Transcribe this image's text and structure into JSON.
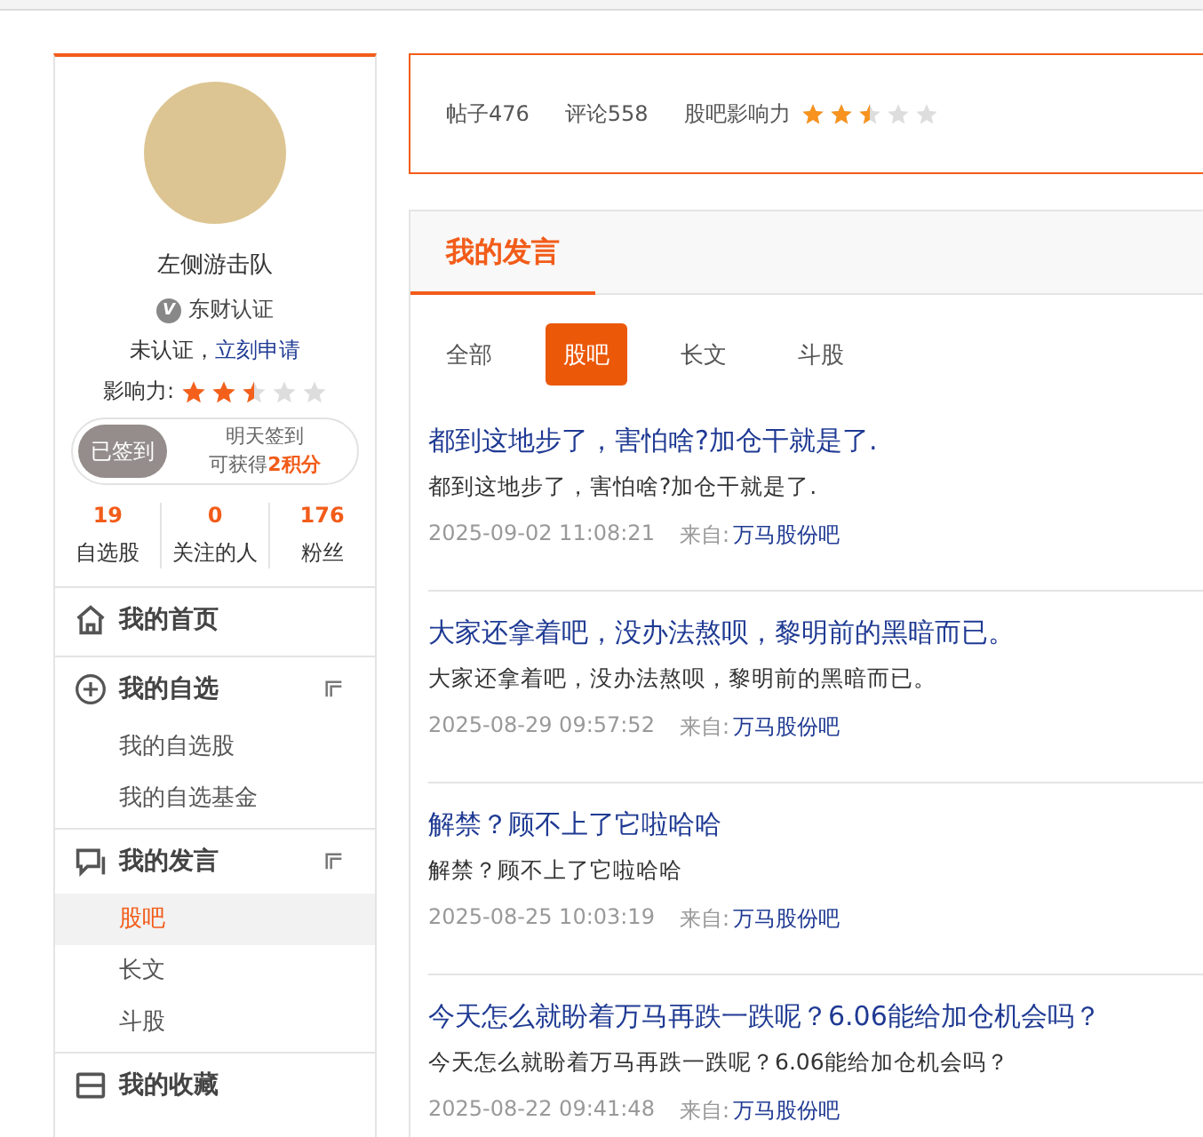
{
  "profile": {
    "name": "左侧游击队",
    "verify_label": "东财认证",
    "verify_icon": "V",
    "verify_status": "未认证，",
    "verify_link": "立刻申请",
    "influence_label": "影响力:",
    "stars": 2.5,
    "checkin": {
      "button": "已签到",
      "checked": true,
      "line1": "明天签到",
      "line2_prefix": "可获得",
      "line2_points": "2积分"
    },
    "counts": [
      {
        "value": "19",
        "label": "自选股"
      },
      {
        "value": "0",
        "label": "关注的人"
      },
      {
        "value": "176",
        "label": "粉丝"
      }
    ]
  },
  "menu": [
    {
      "kind": "home",
      "title": "我的首页"
    },
    {
      "kind": "plus",
      "title": "我的自选",
      "collapsible": true,
      "children": [
        {
          "label": "我的自选股",
          "selected": false
        },
        {
          "label": "我的自选基金",
          "selected": false
        }
      ]
    },
    {
      "kind": "chat",
      "title": "我的发言",
      "collapsible": true,
      "children": [
        {
          "label": "股吧",
          "selected": true
        },
        {
          "label": "长文",
          "selected": false
        },
        {
          "label": "斗股",
          "selected": false
        }
      ]
    },
    {
      "kind": "box",
      "title": "我的收藏"
    }
  ],
  "stats": {
    "posts": "帖子476",
    "comments": "评论558",
    "influence_label": "股吧影响力",
    "stars": 2.5
  },
  "section": {
    "title": "我的发言",
    "tabs": [
      {
        "label": "全部",
        "selected": false
      },
      {
        "label": "股吧",
        "selected": true
      },
      {
        "label": "长文",
        "selected": false
      },
      {
        "label": "斗股",
        "selected": false
      }
    ],
    "posts": [
      {
        "title": "都到这地步了，害怕啥?加仓干就是了.",
        "body": "都到这地步了，害怕啥?加仓干就是了.",
        "time": "2025-09-02 11:08:21",
        "from_label": "来自:",
        "from": "万马股份吧"
      },
      {
        "title": "大家还拿着吧，没办法熬呗，黎明前的黑暗而已。",
        "body": "大家还拿着吧，没办法熬呗，黎明前的黑暗而已。",
        "time": "2025-08-29 09:57:52",
        "from_label": "来自:",
        "from": "万马股份吧"
      },
      {
        "title": "解禁？顾不上了它啦哈哈",
        "body": "解禁？顾不上了它啦哈哈",
        "time": "2025-08-25 10:03:19",
        "from_label": "来自:",
        "from": "万马股份吧"
      },
      {
        "title": "今天怎么就盼着万马再跌一跌呢？6.06能给加仓机会吗？",
        "body": "今天怎么就盼着万马再跌一跌呢？6.06能给加仓机会吗？",
        "time": "2025-08-22 09:41:48",
        "from_label": "来自:",
        "from": "万马股份吧"
      }
    ]
  }
}
